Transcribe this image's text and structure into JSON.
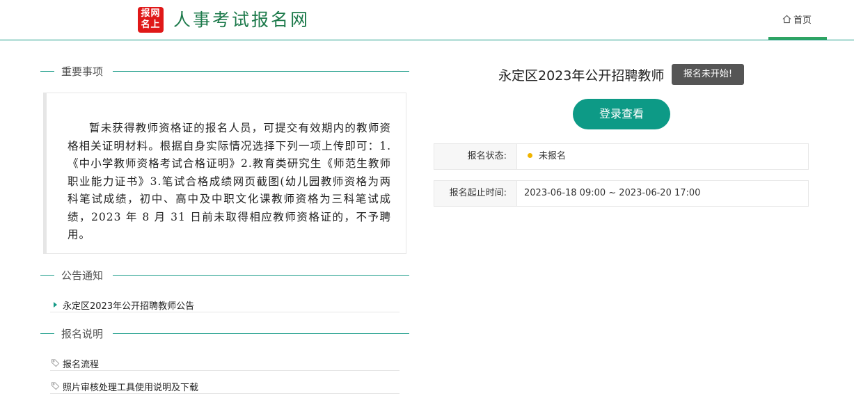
{
  "header": {
    "logo_chars_row1": "报网",
    "logo_chars_row2": "名上",
    "site_title": "人事考试报名网",
    "nav_home": "首页"
  },
  "sections": {
    "important": {
      "title": "重要事项",
      "text": "暂未获得教师资格证的报名人员，可提交有效期内的教师资格相关证明材料。根据自身实际情况选择下列一项上传即可：1.《中小学教师资格考试合格证明》2.教育类研究生《师范生教师职业能力证书》3.笔试合格成绩网页截图(幼儿园教师资格为两科笔试成绩，初中、高中及中职文化课教师资格为三科笔试成绩，2023 年 8 月 31 日前未取得相应教师资格证的，不予聘用。"
    },
    "announcement": {
      "title": "公告通知",
      "items": [
        "永定区2023年公开招聘教师公告"
      ]
    },
    "instructions": {
      "title": "报名说明",
      "items": [
        "报名流程",
        "照片审核处理工具使用说明及下载"
      ]
    }
  },
  "exam": {
    "title": "永定区2023年公开招聘教师",
    "status_badge": "报名未开始!",
    "login_button": "登录查看",
    "status_label": "报名状态:",
    "status_value": "未报名",
    "period_label": "报名起止时间:",
    "period_value": "2023-06-18 09:00 ~ 2023-06-20 17:00"
  },
  "colors": {
    "accent": "#0d9a86",
    "logo_red": "#e01818",
    "status_dot": "#f0b400"
  }
}
